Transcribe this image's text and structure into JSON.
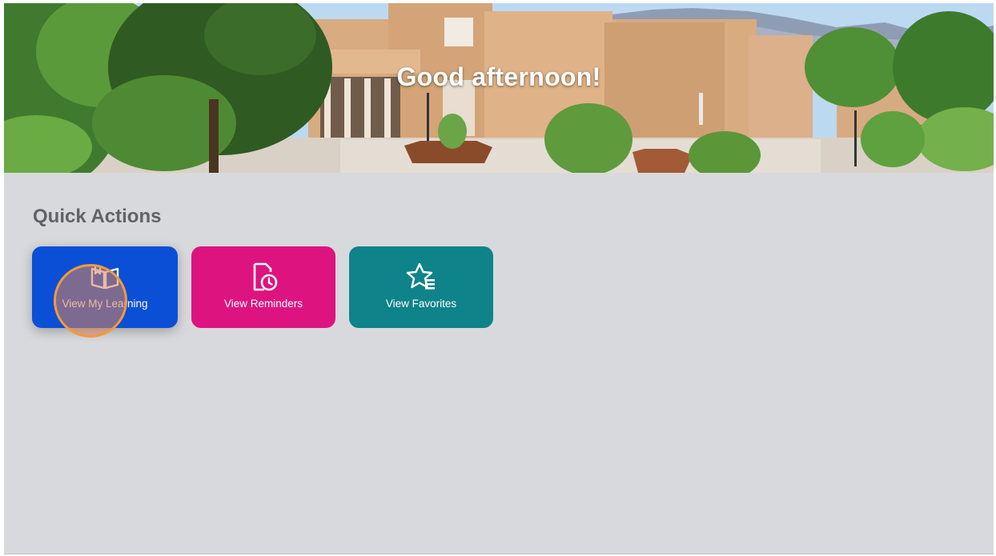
{
  "hero": {
    "greeting": "Good afternoon!"
  },
  "quick_actions": {
    "title": "Quick Actions",
    "items": [
      {
        "label": "View My Learning",
        "icon": "open-book-icon",
        "color": "#0b4fd6"
      },
      {
        "label": "View Reminders",
        "icon": "document-clock-icon",
        "color": "#dd1480"
      },
      {
        "label": "View Favorites",
        "icon": "star-list-icon",
        "color": "#0e8389"
      }
    ]
  },
  "colors": {
    "background": "#d8d9dc",
    "title_text": "#5f6369",
    "cursor_highlight": "#f39a3c"
  }
}
